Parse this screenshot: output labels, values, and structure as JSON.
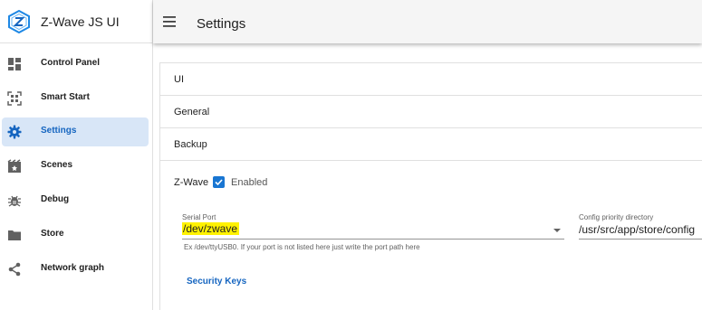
{
  "app": {
    "title": "Z-Wave JS UI"
  },
  "sidebar": {
    "items": [
      {
        "label": "Control Panel",
        "icon": "view-dashboard-icon"
      },
      {
        "label": "Smart Start",
        "icon": "qr-code-icon"
      },
      {
        "label": "Settings",
        "icon": "gear-icon",
        "active": true
      },
      {
        "label": "Scenes",
        "icon": "movie-clapper-icon"
      },
      {
        "label": "Debug",
        "icon": "bug-icon"
      },
      {
        "label": "Store",
        "icon": "folder-icon"
      },
      {
        "label": "Network graph",
        "icon": "share-icon"
      }
    ]
  },
  "topbar": {
    "title": "Settings"
  },
  "sections": {
    "ui": "UI",
    "general": "General",
    "backup": "Backup"
  },
  "zwave": {
    "label": "Z-Wave",
    "enabled_label": "Enabled",
    "enabled": true,
    "serial_port": {
      "label": "Serial Port",
      "value": "/dev/zwave",
      "hint": "Ex /dev/ttyUSB0. If your port is not listed here just write the port path here"
    },
    "config_priority": {
      "label": "Config priority directory",
      "value": "/usr/src/app/store/config"
    },
    "security_keys_label": "Security Keys"
  },
  "colors": {
    "accent": "#1976d2",
    "active_bg": "#d8e6f7",
    "highlight": "#fff200"
  }
}
